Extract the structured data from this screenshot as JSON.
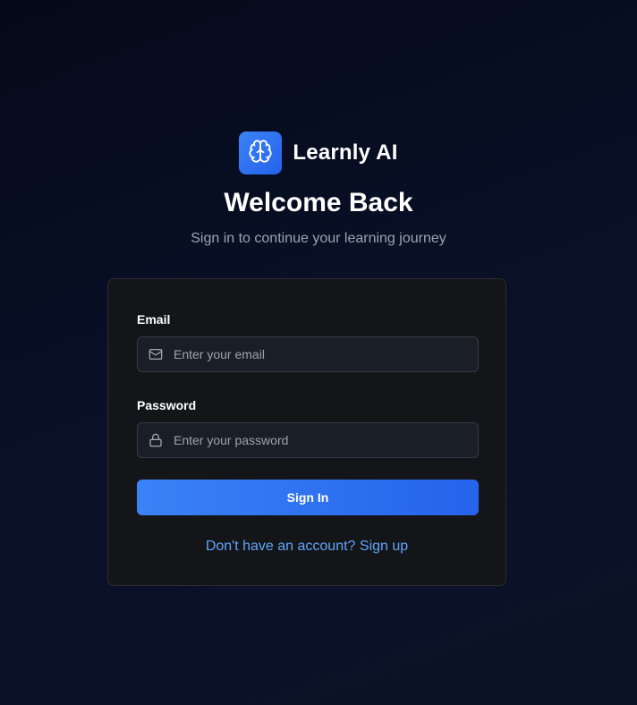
{
  "brand": {
    "name": "Learnly AI",
    "logo_icon": "brain-icon",
    "accent_color": "#3b82f6"
  },
  "header": {
    "title": "Welcome Back",
    "subtitle": "Sign in to continue your learning journey"
  },
  "form": {
    "email": {
      "label": "Email",
      "placeholder": "Enter your email",
      "value": "",
      "icon": "mail-icon"
    },
    "password": {
      "label": "Password",
      "placeholder": "Enter your password",
      "value": "",
      "icon": "lock-icon"
    },
    "submit_label": "Sign In",
    "signup_text": "Don't have an account? Sign up"
  }
}
